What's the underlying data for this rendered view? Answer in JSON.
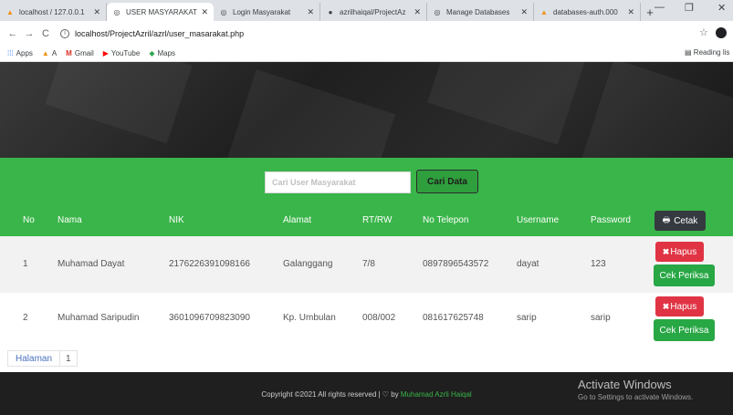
{
  "browser": {
    "tabs": [
      {
        "title": "localhost / 127.0.0.1",
        "icon": "phpmyadmin-icon",
        "active": false
      },
      {
        "title": "USER MASYARAKAT",
        "icon": "globe-icon",
        "active": true
      },
      {
        "title": "Login Masyarakat",
        "icon": "globe-icon",
        "active": false
      },
      {
        "title": "azrilhaiqal/ProjectAz",
        "icon": "github-icon",
        "active": false
      },
      {
        "title": "Manage Databases",
        "icon": "globe-icon",
        "active": false
      },
      {
        "title": "databases-auth.000",
        "icon": "phpmyadmin-icon",
        "active": false
      }
    ],
    "url": "localhost/ProjectAzril/azrl/user_masarakat.php",
    "bookmarks": [
      {
        "label": "Apps",
        "icon": "apps-grid-icon"
      },
      {
        "label": "A",
        "icon": "phpmyadmin-icon"
      },
      {
        "label": "Gmail",
        "icon": "gmail-icon"
      },
      {
        "label": "YouTube",
        "icon": "youtube-icon"
      },
      {
        "label": "Maps",
        "icon": "maps-icon"
      }
    ],
    "reading_list": "Reading lis"
  },
  "search": {
    "placeholder": "Cari User Masyarakat",
    "button": "Cari Data"
  },
  "table": {
    "headers": {
      "no": "No",
      "nama": "Nama",
      "nik": "NIK",
      "alamat": "Alamat",
      "rtrw": "RT/RW",
      "telepon": "No Telepon",
      "username": "Username",
      "password": "Password"
    },
    "print_button": "Cetak",
    "rows": [
      {
        "no": "1",
        "nama": "Muhamad Dayat",
        "nik": "2176226391098166",
        "alamat": "Galanggang",
        "rtrw": "7/8",
        "telepon": "0897896543572",
        "username": "dayat",
        "password": "123",
        "hapus": "Hapus",
        "cek": "Cek Periksa"
      },
      {
        "no": "2",
        "nama": "Muhamad Saripudin",
        "nik": "3601096709823090",
        "alamat": "Kp. Umbulan",
        "rtrw": "008/002",
        "telepon": "081617625748",
        "username": "sarip",
        "password": "sarip",
        "hapus": "Hapus",
        "cek": "Cek Periksa"
      }
    ]
  },
  "pagination": {
    "label": "Halaman",
    "page": "1"
  },
  "footer": {
    "copyright": "Copyright ©2021 All rights reserved | ♡ by",
    "author": "Muhamad Azrli Haiqal"
  },
  "windows_watermark": {
    "title": "Activate Windows",
    "subtitle": "Go to Settings to activate Windows."
  },
  "colors": {
    "accent_green": "#3ab54a",
    "danger_red": "#e03444",
    "success_green": "#28a745",
    "dark_button": "#343a40",
    "footer_bg": "#1f1f1f"
  }
}
